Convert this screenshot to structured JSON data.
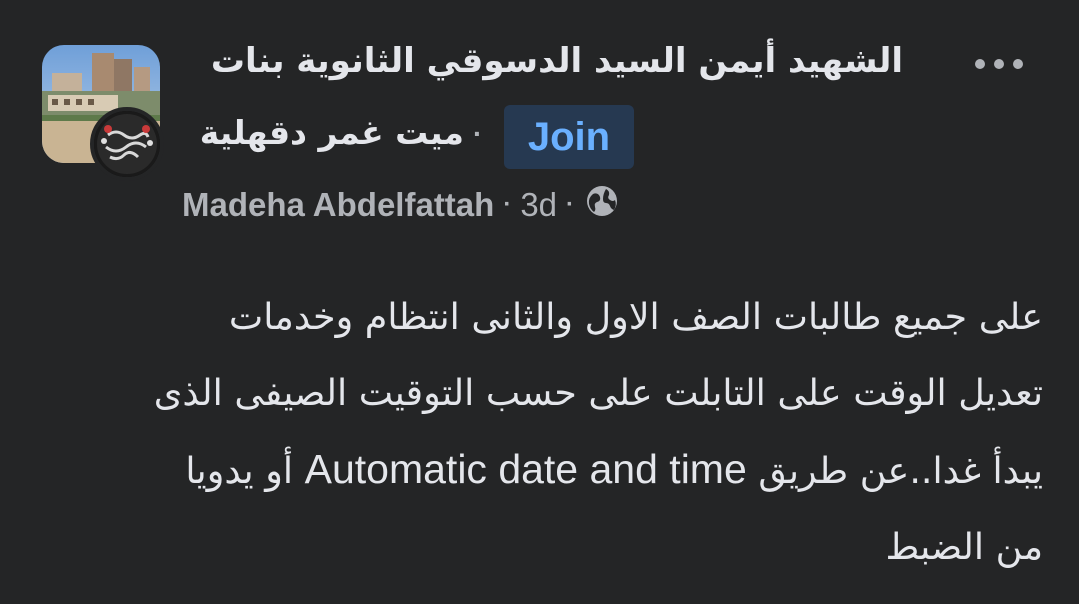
{
  "header": {
    "group_name_line1": "الشهيد أيمن السيد الدسوقي الثانوية بنات",
    "group_name_line2": "ميت غمر دقهلية",
    "separator": "·",
    "join_label": "Join"
  },
  "meta": {
    "author": "Madeha Abdelfattah",
    "dot": "·",
    "time": "3d",
    "privacy_icon": "globe-icon"
  },
  "post": {
    "line1": "على جميع طالبات الصف الاول والثانى انتظام وخدمات",
    "line2": "تعديل الوقت على التابلت على حسب التوقيت الصيفى الذى",
    "line3_part1": "يبدأ غدا..عن طريق",
    "line3_ltr": "Automatic date and time",
    "line3_part2": "أو يدويا",
    "line4": "من الضبط"
  },
  "icons": {
    "more": "more-dots-icon"
  },
  "colors": {
    "background": "#242526",
    "primary_text": "#e4e6eb",
    "secondary_text": "#b0b3b8",
    "join_bg": "#263951",
    "join_text": "#6ab0ff"
  }
}
